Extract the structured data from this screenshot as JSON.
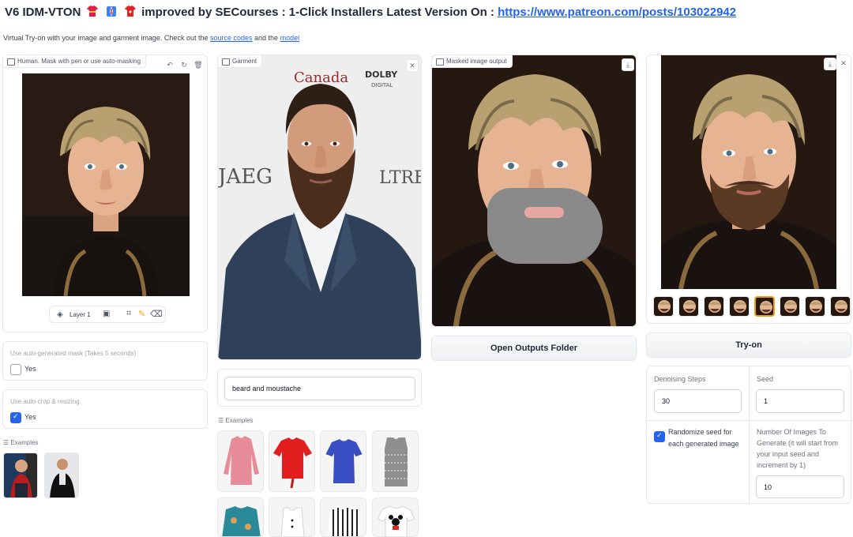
{
  "header": {
    "title_prefix": "V6 IDM-VTON",
    "title_suffix": "improved by SECourses : 1-Click Installers Latest Version On :",
    "title_link": "https://www.patreon.com/posts/103022942",
    "subtitle_prefix": "Virtual Try-on with your image and garment image. Check out the",
    "subtitle_link1": "source codes",
    "subtitle_and": "and the",
    "subtitle_link2": "model"
  },
  "human": {
    "label": "Human. Mask with pen or use auto-masking",
    "layer_label": "Layer 1",
    "auto_mask_label": "Use auto-generated mask (Takes 5 seconds)",
    "auto_mask_option": "Yes",
    "auto_mask_checked": false,
    "auto_crop_label": "Use auto-crop & resizing",
    "auto_crop_option": "Yes",
    "auto_crop_checked": true,
    "examples_label": "Examples"
  },
  "garment": {
    "label": "Garment",
    "description_value": "beard and moustache",
    "examples_label": "Examples",
    "backdrop_texts": [
      "Canada",
      "DOLBY",
      "DIGITAL",
      "JAEG",
      "LTRE"
    ]
  },
  "masked": {
    "label": "Masked image output",
    "open_folder_button": "Open Outputs Folder"
  },
  "output": {
    "tryon_button": "Try-on",
    "gallery_count": 8,
    "selected_index": 4,
    "denoising_label": "Denoising Steps",
    "denoising_value": "30",
    "seed_label": "Seed",
    "seed_value": "1",
    "randomize_label": "Randomize seed for each generated image",
    "randomize_checked": true,
    "num_images_label": "Number Of Images To Generate (it will start from your input seed and increment by 1)",
    "num_images_value": "10"
  },
  "colors": {
    "accent": "#2563eb",
    "mask_grey": "#8a8a8a",
    "panel_border": "#e5e7eb"
  }
}
